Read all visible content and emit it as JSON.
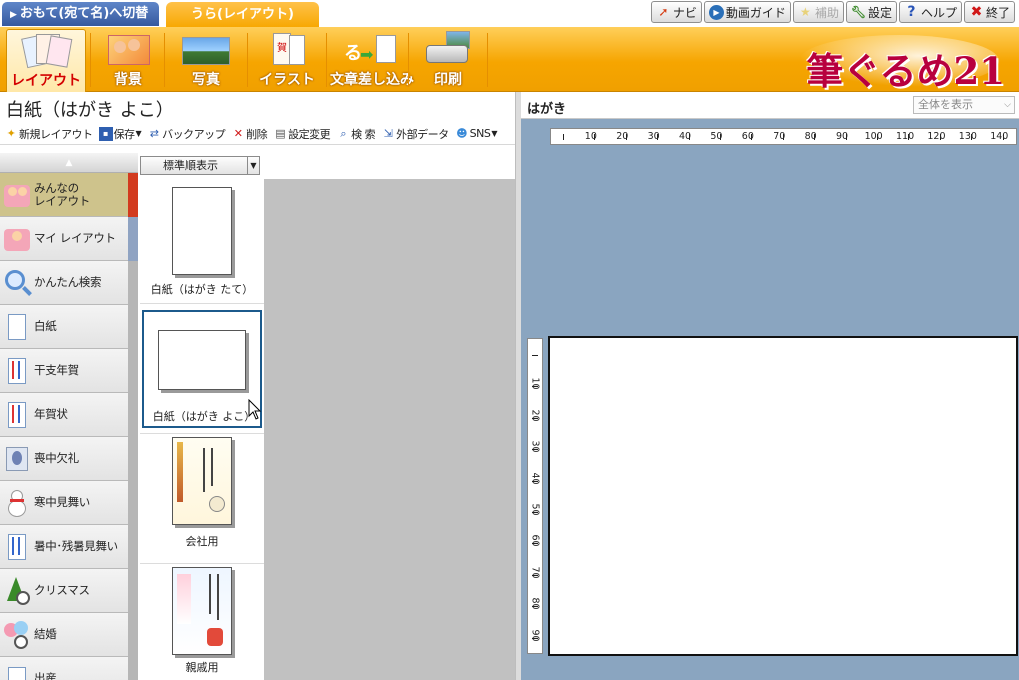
{
  "tabs": {
    "omote": "おもて(宛て名)へ切替",
    "ura": "うら(レイアウト)"
  },
  "top_buttons": [
    {
      "label": "ナビ",
      "icon": "navi-arrow-icon",
      "enabled": true
    },
    {
      "label": "動画ガイド",
      "icon": "play-icon",
      "enabled": true
    },
    {
      "label": "補助",
      "icon": "star-icon",
      "enabled": false
    },
    {
      "label": "設定",
      "icon": "wrench-icon",
      "enabled": true
    },
    {
      "label": "ヘルプ",
      "icon": "question-icon",
      "enabled": true
    },
    {
      "label": "終了",
      "icon": "close-icon",
      "enabled": true
    }
  ],
  "modes": [
    {
      "label": "レイアウト",
      "active": true
    },
    {
      "label": "背景",
      "active": false
    },
    {
      "label": "写真",
      "active": false
    },
    {
      "label": "イラスト",
      "active": false
    },
    {
      "label": "文章差し込み",
      "active": false
    },
    {
      "label": "印刷",
      "active": false
    }
  ],
  "logo_text": "筆ぐるめ21",
  "layout_title": "白紙（はがき よこ）",
  "toolbar": {
    "new_layout": "新規レイアウト",
    "save": "保存",
    "backup": "バックアップ",
    "delete": "削除",
    "settings_change": "設定変更",
    "search": "検 索",
    "external_data": "外部データ",
    "sns": "SNS"
  },
  "sort_option": "標準順表示",
  "categories": [
    {
      "label": "みんなの\nレイアウト",
      "active": true
    },
    {
      "label": "マイ レイアウト",
      "active": false
    },
    {
      "label": "かんたん検索",
      "active": false
    },
    {
      "label": "白紙",
      "active": false
    },
    {
      "label": "干支年賀",
      "active": false
    },
    {
      "label": "年賀状",
      "active": false
    },
    {
      "label": "喪中欠礼",
      "active": false
    },
    {
      "label": "寒中見舞い",
      "active": false
    },
    {
      "label": "暑中･残暑見舞い",
      "active": false
    },
    {
      "label": "クリスマス",
      "active": false
    },
    {
      "label": "結婚",
      "active": false
    },
    {
      "label": "出産",
      "active": false
    }
  ],
  "thumbnails": [
    {
      "label": "白紙（はがき たて）",
      "selected": false
    },
    {
      "label": "白紙（はがき よこ）",
      "selected": true
    },
    {
      "label": "会社用",
      "selected": false
    },
    {
      "label": "親戚用",
      "selected": false
    }
  ],
  "preview": {
    "title": "はがき",
    "zoom": "全体を表示",
    "hruler_labels": [
      "10",
      "20",
      "30",
      "40",
      "50",
      "60",
      "70",
      "80",
      "90",
      "100",
      "110",
      "120",
      "130",
      "140"
    ],
    "vruler_labels": [
      "10",
      "20",
      "30",
      "40",
      "50",
      "60",
      "70",
      "80",
      "90"
    ]
  },
  "colors": {
    "orange": "#f6a500",
    "omote_tab": "#36599e",
    "canvas_bg": "#8aa5c0",
    "selected_border": "#1c5a8c",
    "logo": "#b8003e"
  }
}
